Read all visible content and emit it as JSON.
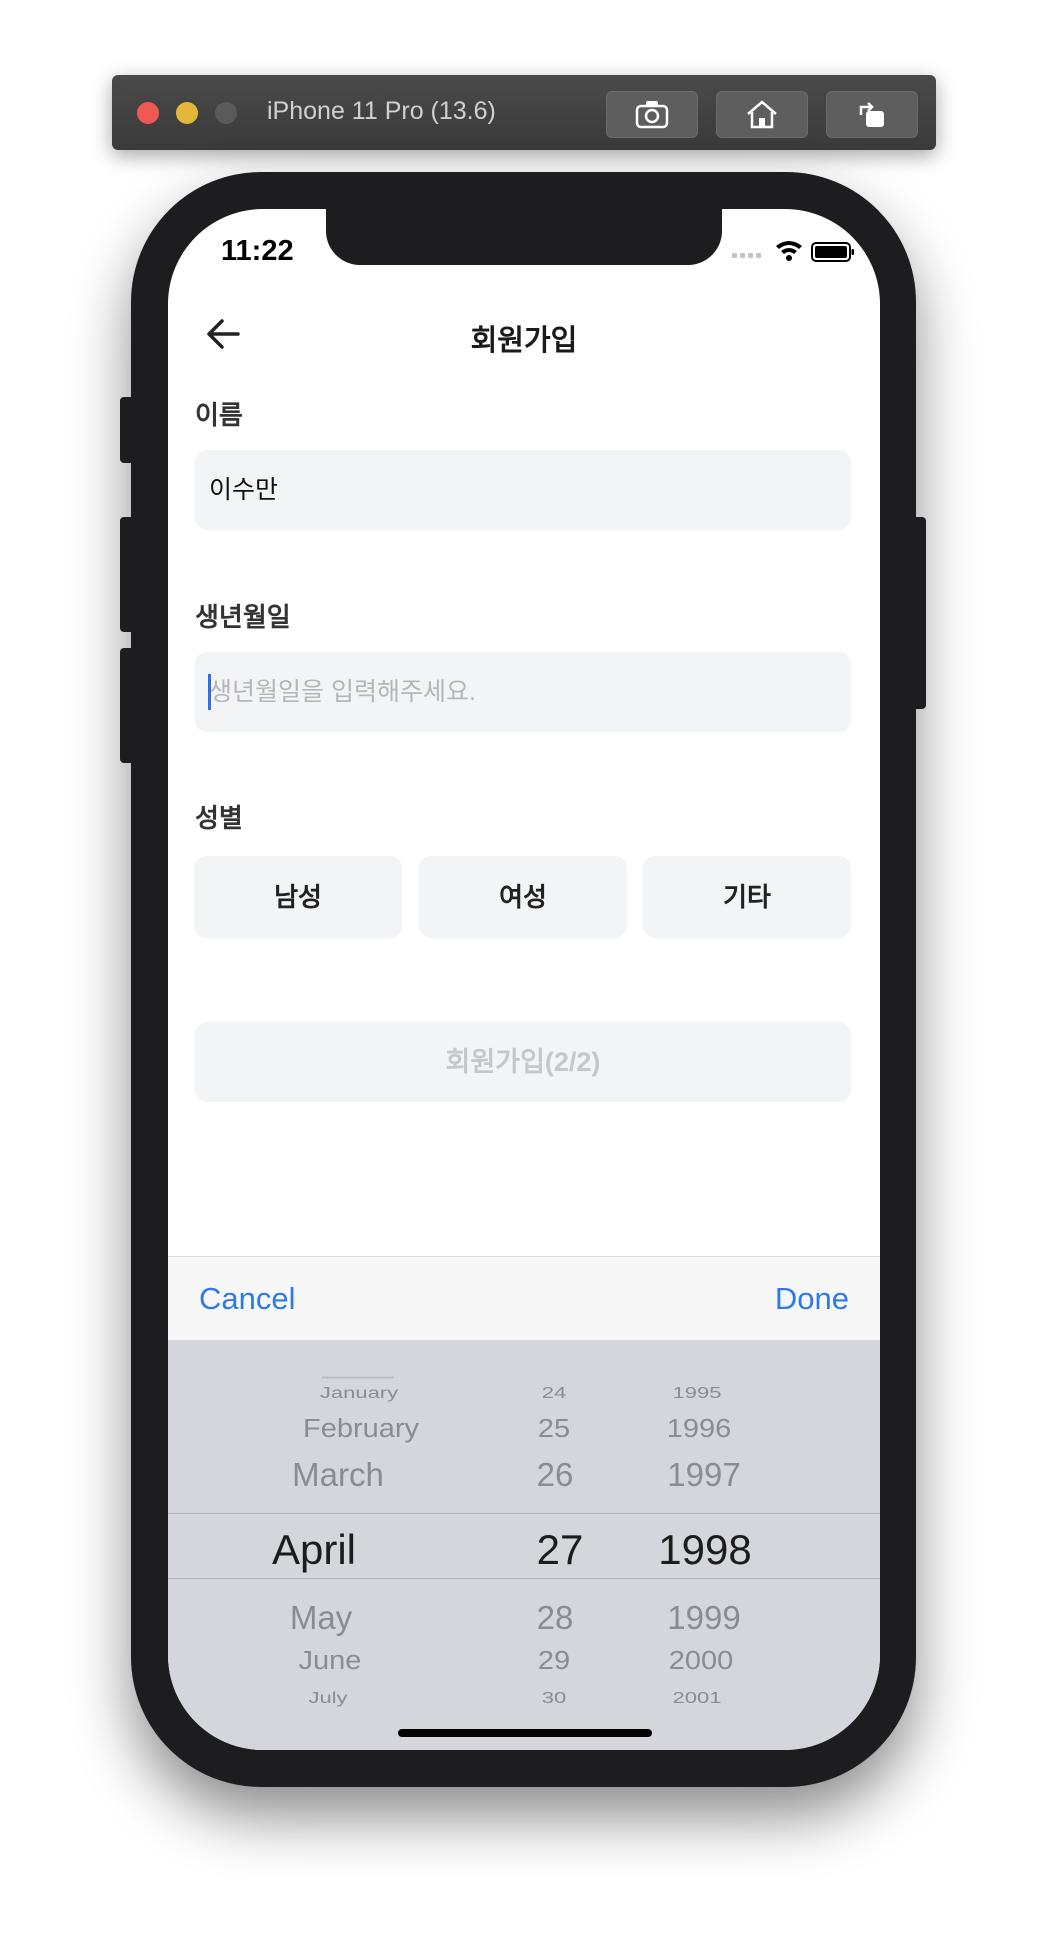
{
  "simulator": {
    "title": "iPhone 11 Pro (13.6)",
    "buttons": [
      "screenshot-icon",
      "home-icon",
      "rotate-icon"
    ]
  },
  "status_bar": {
    "time": "11:22"
  },
  "nav": {
    "title": "회원가입",
    "back_icon": "arrow-left-icon"
  },
  "form": {
    "name_label": "이름",
    "name_value": "이수만",
    "birth_label": "생년월일",
    "birth_placeholder": "생년월일을 입력해주세요.",
    "gender_label": "성별",
    "gender_options": [
      "남성",
      "여성",
      "기타"
    ],
    "submit_label": "회원가입(2/2)"
  },
  "toolbar": {
    "cancel": "Cancel",
    "done": "Done"
  },
  "picker": {
    "months": [
      "January",
      "February",
      "March",
      "April",
      "May",
      "June",
      "July"
    ],
    "days": [
      "24",
      "25",
      "26",
      "27",
      "28",
      "29",
      "30"
    ],
    "years": [
      "1995",
      "1996",
      "1997",
      "1998",
      "1999",
      "2000",
      "2001"
    ],
    "selected": {
      "month": "April",
      "day": "27",
      "year": "1998"
    }
  },
  "colors": {
    "accent": "#2f7ae6",
    "field_bg": "#f3f4f6",
    "picker_bg": "#d5d6db"
  }
}
